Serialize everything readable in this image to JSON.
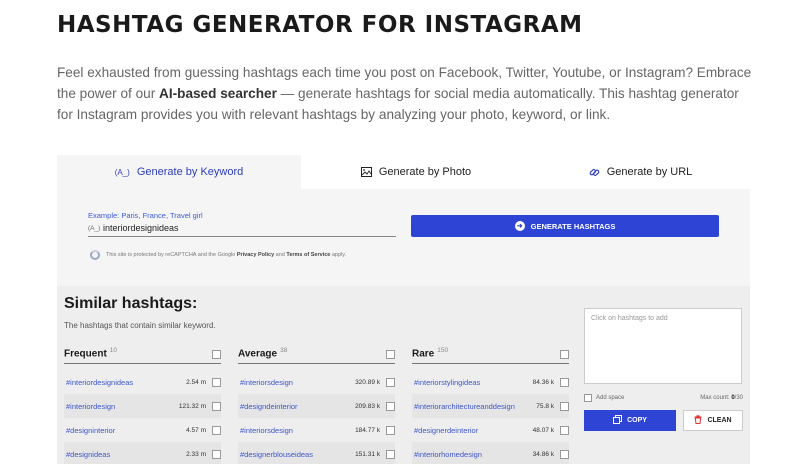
{
  "header": {
    "title": "HASHTAG GENERATOR FOR INSTAGRAM",
    "intro_before": "Feel exhausted from guessing hashtags each time you post on Facebook, Twitter, Youtube, or Instagram? Embrace the power of our ",
    "intro_bold": "AI-based searcher",
    "intro_after": " — generate hashtags for social media automatically. This hashtag generator for Instagram provides you with relevant hashtags by analyzing your photo, keyword, or link."
  },
  "tabs": [
    {
      "label": "Generate by Keyword",
      "icon": "keyword-icon",
      "icon_glyph": "(A_)",
      "active": true
    },
    {
      "label": "Generate by Photo",
      "icon": "image-icon",
      "active": false
    },
    {
      "label": "Generate by URL",
      "icon": "link-icon",
      "active": false
    }
  ],
  "search": {
    "hint": "Example: Paris, France, Travel girl",
    "value": "interiordesignideas",
    "icon_glyph": "(A_)",
    "button_label": "GENERATE HASHTAGS",
    "captcha_before": "This site is protected by reCAPTCHA and the Google ",
    "captcha_privacy": "Privacy Policy",
    "captcha_and": " and ",
    "captcha_terms": "Terms of Service",
    "captcha_after": " apply."
  },
  "similar": {
    "title": "Similar hashtags:",
    "subtitle": "The hashtags that contain similar keyword.",
    "columns": [
      {
        "name": "Frequent",
        "count": "10",
        "rows": [
          {
            "tag": "#interiordesignideas",
            "num": "2.54 m"
          },
          {
            "tag": "#interiordesign",
            "num": "121.32 m"
          },
          {
            "tag": "#designinterior",
            "num": "4.57 m"
          },
          {
            "tag": "#designideas",
            "num": "2.33 m"
          }
        ]
      },
      {
        "name": "Average",
        "count": "38",
        "rows": [
          {
            "tag": "#interiorsdesign",
            "num": "320.89 k"
          },
          {
            "tag": "#designdeinterior",
            "num": "209.83 k"
          },
          {
            "tag": "#interiorsdesign",
            "num": "184.77 k"
          },
          {
            "tag": "#designerblouseideas",
            "num": "151.31 k"
          }
        ]
      },
      {
        "name": "Rare",
        "count": "150",
        "rows": [
          {
            "tag": "#interiorstylingideas",
            "num": "84.36 k"
          },
          {
            "tag": "#interiorarchitectureanddesign",
            "num": "75.8 k"
          },
          {
            "tag": "#designerdeinterior",
            "num": "48.07 k"
          },
          {
            "tag": "#interiorhomedesign",
            "num": "34.86 k"
          }
        ]
      }
    ]
  },
  "panel": {
    "placeholder": "Click on hashtags to add",
    "add_space": "Add space",
    "max_count_label": "Max count: ",
    "max_count_value": "0",
    "max_count_total": "/30",
    "copy_label": "COPY",
    "clean_label": "CLEAN"
  },
  "colors": {
    "accent": "#2e44d4",
    "link": "#3d56c9",
    "tool_bg": "#f5f5f5",
    "results_bg": "#eeeeee"
  }
}
